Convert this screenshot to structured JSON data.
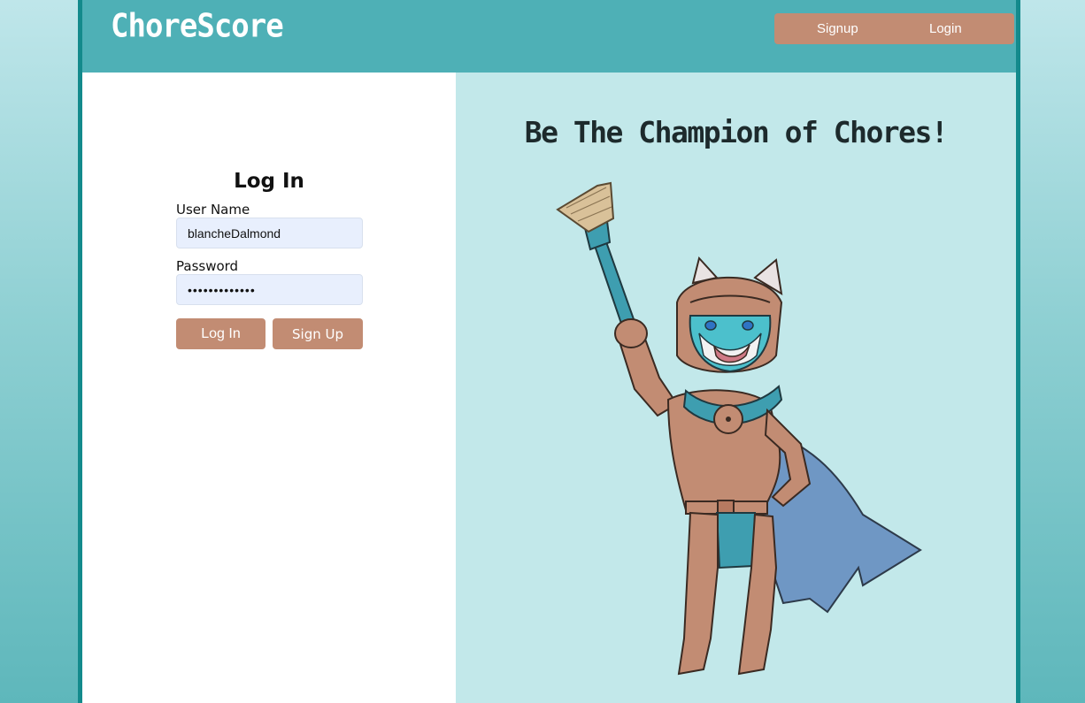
{
  "brand": {
    "name": "ChoreScore"
  },
  "nav": {
    "signup_label": "Signup",
    "login_label": "Login"
  },
  "login_form": {
    "title": "Log In",
    "username_label": "User Name",
    "username_value": "blancheDalmond",
    "password_label": "Password",
    "password_value": "•••••••••••••",
    "login_button": "Log In",
    "signup_button": "Sign Up"
  },
  "hero": {
    "tagline": "Be The Champion of Chores!",
    "illustration": "knight-cat-with-broom-illustration"
  },
  "colors": {
    "header": "#4eb0b6",
    "frame": "#138a8c",
    "accent": "#c28c73",
    "hero_bg": "#c2e8ea",
    "input_bg": "#e8effd"
  }
}
